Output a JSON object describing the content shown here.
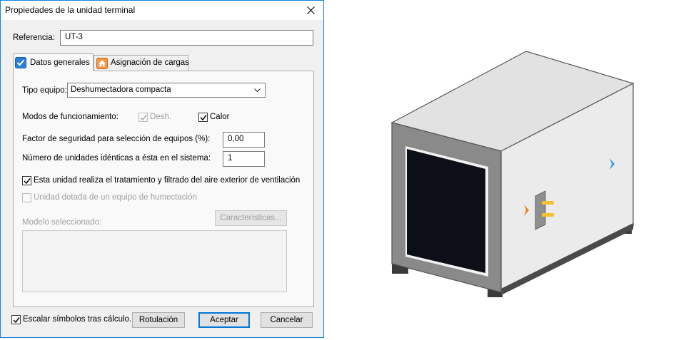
{
  "window": {
    "title": "Propiedades de la unidad terminal"
  },
  "reference": {
    "label": "Referencia:",
    "value": "UT-3"
  },
  "tabs": [
    {
      "label": "Datos generales",
      "icon": "checkbox-tab-icon",
      "active": true
    },
    {
      "label": "Asignación de cargas",
      "icon": "house-tab-icon",
      "active": false
    }
  ],
  "general": {
    "equipment_type_label": "Tipo equipo:",
    "equipment_type_value": "Deshumectadora compacta",
    "modes_label": "Modos de funcionamiento:",
    "mode_desh": {
      "label": "Desh.",
      "checked": true,
      "enabled": false
    },
    "mode_calor": {
      "label": "Calor",
      "checked": true,
      "enabled": true
    },
    "safety_factor_label": "Factor de seguridad para selección de equipos (%):",
    "safety_factor_value": "0,00",
    "identical_units_label": "Número de unidades idénticas a ésta en el sistema:",
    "identical_units_value": "1",
    "ventilation_treatment": {
      "label": "Esta unidad realiza el tratamiento y filtrado del aire exterior de ventilación",
      "checked": true,
      "enabled": true
    },
    "humidification": {
      "label": "Unidad dotada de un equipo de humectación",
      "checked": false,
      "enabled": false
    },
    "model_label": "Modelo seleccionado:",
    "characteristics_button": "Características..."
  },
  "footer": {
    "scale_symbols": {
      "label": "Escalar símbolos tras cálculo.",
      "checked": true
    },
    "labeling_button": "Rotulación",
    "accept_button": "Aceptar",
    "cancel_button": "Cancelar"
  },
  "colors": {
    "accent": "#0078d7",
    "window_border": "#1883d7",
    "unit_body": "#e6e6e6",
    "unit_frame": "#8a8a8a",
    "unit_grille": "#0d0f18",
    "pipe_connector": "#f2c230",
    "inlet_arrow": "#3a9ad9",
    "outlet_arrow": "#f07f22"
  }
}
